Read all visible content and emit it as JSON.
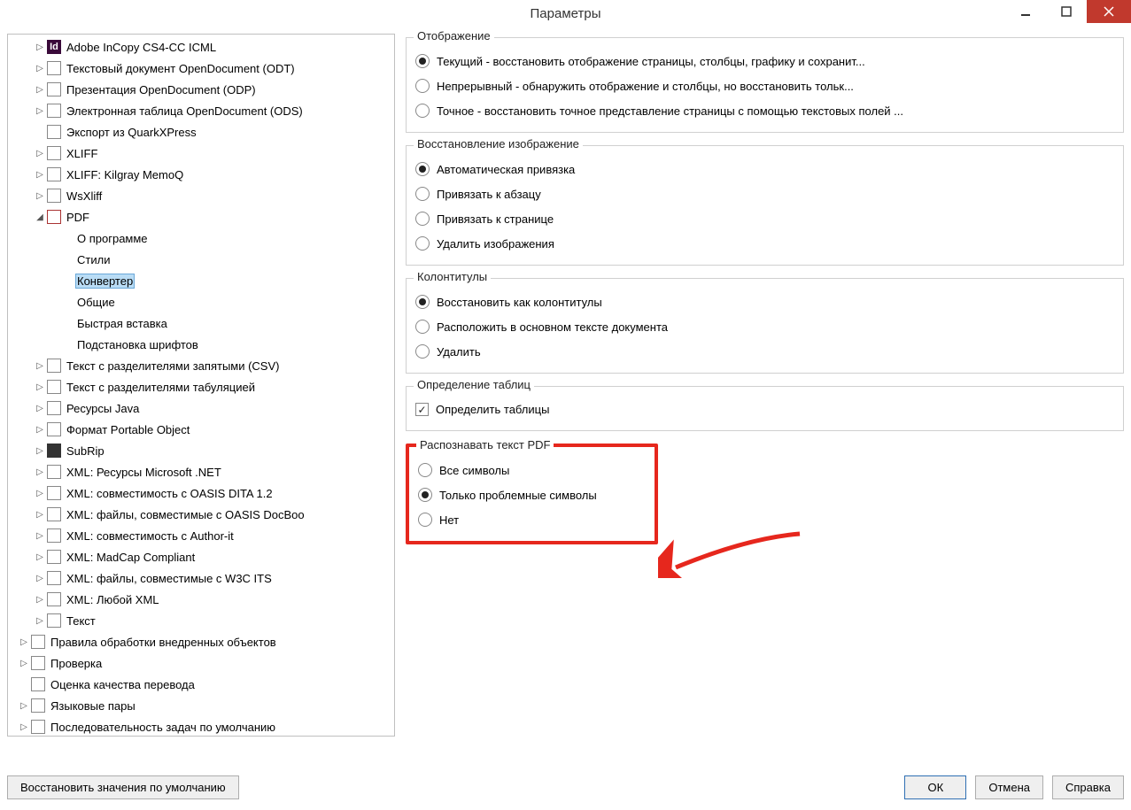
{
  "window": {
    "title": "Параметры"
  },
  "tree": {
    "items": [
      {
        "id": "icml",
        "indent": 30,
        "exp": "right",
        "icon": "ic-id",
        "iconText": "Id",
        "label": "Adobe InCopy CS4-CC ICML"
      },
      {
        "id": "odt",
        "indent": 30,
        "exp": "right",
        "icon": "ic-odt",
        "iconText": "",
        "label": "Текстовый документ OpenDocument (ODT)"
      },
      {
        "id": "odp",
        "indent": 30,
        "exp": "right",
        "icon": "ic-odp",
        "iconText": "",
        "label": "Презентация OpenDocument (ODP)"
      },
      {
        "id": "ods",
        "indent": 30,
        "exp": "right",
        "icon": "ic-ods",
        "iconText": "",
        "label": "Электронная таблица OpenDocument (ODS)"
      },
      {
        "id": "qxp",
        "indent": 30,
        "exp": "none",
        "icon": "ic-qxp",
        "iconText": "",
        "label": "Экспорт из QuarkXPress"
      },
      {
        "id": "xliff",
        "indent": 30,
        "exp": "right",
        "icon": "ic-xlf",
        "iconText": "",
        "label": "XLIFF"
      },
      {
        "id": "memoq",
        "indent": 30,
        "exp": "right",
        "icon": "ic-xlf",
        "iconText": "",
        "label": "XLIFF: Kilgray MemoQ"
      },
      {
        "id": "wsxliff",
        "indent": 30,
        "exp": "right",
        "icon": "ic-ws",
        "iconText": "",
        "label": "WsXliff"
      },
      {
        "id": "pdf",
        "indent": 30,
        "exp": "down",
        "icon": "ic-pdf",
        "iconText": "",
        "label": "PDF"
      },
      {
        "id": "pdf-about",
        "indent": 62,
        "exp": "none",
        "icon": "",
        "iconText": "",
        "label": "О программе"
      },
      {
        "id": "pdf-styles",
        "indent": 62,
        "exp": "none",
        "icon": "",
        "iconText": "",
        "label": "Стили"
      },
      {
        "id": "pdf-conv",
        "indent": 62,
        "exp": "none",
        "icon": "",
        "iconText": "",
        "label": "Конвертер",
        "selected": true
      },
      {
        "id": "pdf-general",
        "indent": 62,
        "exp": "none",
        "icon": "",
        "iconText": "",
        "label": "Общие"
      },
      {
        "id": "pdf-quick",
        "indent": 62,
        "exp": "none",
        "icon": "",
        "iconText": "",
        "label": "Быстрая вставка"
      },
      {
        "id": "pdf-fonts",
        "indent": 62,
        "exp": "none",
        "icon": "",
        "iconText": "",
        "label": "Подстановка шрифтов"
      },
      {
        "id": "csv",
        "indent": 30,
        "exp": "right",
        "icon": "ic-csv",
        "iconText": "",
        "label": "Текст с разделителями запятыми (CSV)"
      },
      {
        "id": "tsv",
        "indent": 30,
        "exp": "right",
        "icon": "ic-csv",
        "iconText": "",
        "label": "Текст с разделителями табуляцией"
      },
      {
        "id": "java",
        "indent": 30,
        "exp": "right",
        "icon": "ic-java",
        "iconText": "",
        "label": "Ресурсы Java"
      },
      {
        "id": "po",
        "indent": 30,
        "exp": "right",
        "icon": "ic-po",
        "iconText": "",
        "label": "Формат Portable Object"
      },
      {
        "id": "subrip",
        "indent": 30,
        "exp": "right",
        "icon": "ic-sub",
        "iconText": "",
        "label": "SubRip"
      },
      {
        "id": "xml-net",
        "indent": 30,
        "exp": "right",
        "icon": "ic-xml",
        "iconText": "",
        "label": "XML: Ресурсы Microsoft .NET"
      },
      {
        "id": "xml-dita",
        "indent": 30,
        "exp": "right",
        "icon": "ic-xml",
        "iconText": "",
        "label": "XML: совместимость с OASIS DITA 1.2"
      },
      {
        "id": "xml-docbook",
        "indent": 30,
        "exp": "right",
        "icon": "ic-xml",
        "iconText": "",
        "label": "XML: файлы, совместимые с OASIS DocBoo"
      },
      {
        "id": "xml-authorit",
        "indent": 30,
        "exp": "right",
        "icon": "ic-xml",
        "iconText": "",
        "label": "XML: совместимость с Author-it"
      },
      {
        "id": "xml-madcap",
        "indent": 30,
        "exp": "right",
        "icon": "ic-xml",
        "iconText": "",
        "label": "XML: MadCap Compliant"
      },
      {
        "id": "xml-w3c",
        "indent": 30,
        "exp": "right",
        "icon": "ic-xml",
        "iconText": "",
        "label": "XML: файлы, совместимые с W3C ITS"
      },
      {
        "id": "xml-any",
        "indent": 30,
        "exp": "right",
        "icon": "ic-xml",
        "iconText": "",
        "label": "XML: Любой XML"
      },
      {
        "id": "text",
        "indent": 30,
        "exp": "right",
        "icon": "ic-txt",
        "iconText": "",
        "label": "Текст"
      },
      {
        "id": "rules",
        "indent": 12,
        "exp": "right",
        "icon": "ic-pr",
        "iconText": "",
        "label": "Правила обработки внедренных объектов"
      },
      {
        "id": "check",
        "indent": 12,
        "exp": "right",
        "icon": "ic-chk",
        "iconText": "",
        "label": "Проверка"
      },
      {
        "id": "qa",
        "indent": 12,
        "exp": "none",
        "icon": "ic-qa",
        "iconText": "",
        "label": "Оценка качества перевода"
      },
      {
        "id": "lang",
        "indent": 12,
        "exp": "right",
        "icon": "ic-lang",
        "iconText": "",
        "label": "Языковые пары"
      },
      {
        "id": "seq",
        "indent": 12,
        "exp": "right",
        "icon": "ic-seq",
        "iconText": "",
        "label": "Последовательность задач по умолчанию"
      }
    ]
  },
  "groups": {
    "display": {
      "legend": "Отображение",
      "opts": [
        {
          "id": "disp-cur",
          "label": "Текущий - восстановить отображение страницы, столбцы, графику и сохранит...",
          "checked": true
        },
        {
          "id": "disp-cont",
          "label": "Непрерывный - обнаружить отображение и столбцы, но восстановить тольк...",
          "checked": false
        },
        {
          "id": "disp-exact",
          "label": "Точное - восстановить точное представление страницы с помощью текстовых полей ...",
          "checked": false
        }
      ]
    },
    "images": {
      "legend": "Восстановление изображение",
      "opts": [
        {
          "id": "img-auto",
          "label": "Автоматическая привязка",
          "checked": true
        },
        {
          "id": "img-para",
          "label": "Привязать к абзацу",
          "checked": false
        },
        {
          "id": "img-page",
          "label": "Привязать к странице",
          "checked": false
        },
        {
          "id": "img-del",
          "label": "Удалить изображения",
          "checked": false
        }
      ]
    },
    "headers": {
      "legend": "Колонтитулы",
      "opts": [
        {
          "id": "hdr-restore",
          "label": "Восстановить как колонтитулы",
          "checked": true
        },
        {
          "id": "hdr-body",
          "label": "Расположить в основном тексте документа",
          "checked": false
        },
        {
          "id": "hdr-del",
          "label": "Удалить",
          "checked": false
        }
      ]
    },
    "tables": {
      "legend": "Определение таблиц",
      "check": {
        "id": "tbl-detect",
        "label": "Определить таблицы",
        "checked": true
      }
    },
    "ocr": {
      "legend": "Распознавать текст PDF",
      "opts": [
        {
          "id": "ocr-all",
          "label": "Все символы",
          "checked": false
        },
        {
          "id": "ocr-prob",
          "label": "Только проблемные символы",
          "checked": true
        },
        {
          "id": "ocr-no",
          "label": "Нет",
          "checked": false
        }
      ]
    }
  },
  "buttons": {
    "reset": "Восстановить значения по умолчанию",
    "ok": "ОК",
    "cancel": "Отмена",
    "help": "Справка"
  }
}
